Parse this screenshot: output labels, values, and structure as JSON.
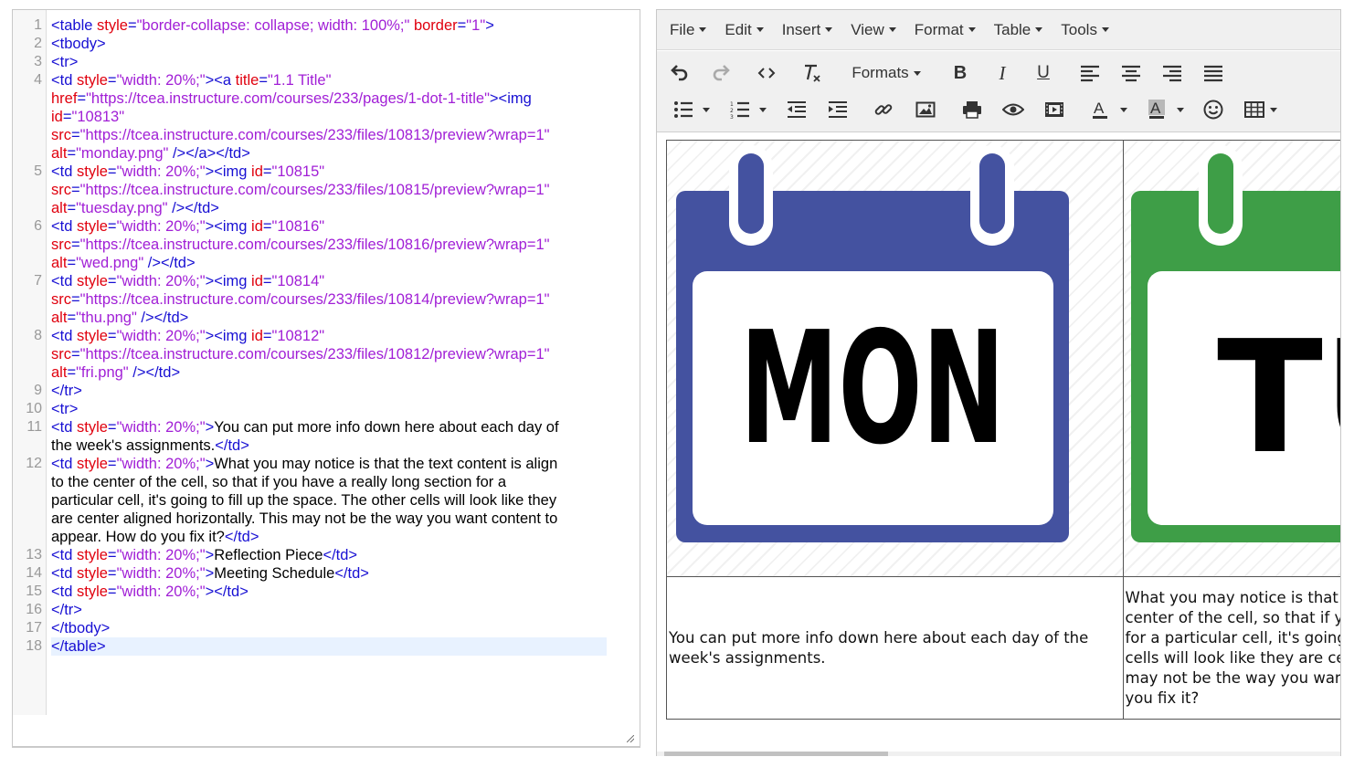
{
  "code_editor": {
    "lines": [
      {
        "n": "1",
        "parts": [
          [
            "t",
            "<table "
          ],
          [
            "a",
            "style"
          ],
          [
            "t",
            "="
          ],
          [
            "s",
            "\"border-collapse: collapse; width: 100%;\""
          ],
          [
            "a",
            " border"
          ],
          [
            "t",
            "="
          ],
          [
            "s",
            "\"1\""
          ],
          [
            "t",
            ">"
          ]
        ]
      },
      {
        "n": "2",
        "parts": [
          [
            "t",
            "<tbody>"
          ]
        ]
      },
      {
        "n": "3",
        "parts": [
          [
            "t",
            "<tr>"
          ]
        ]
      },
      {
        "n": "4",
        "parts": [
          [
            "t",
            "<td "
          ],
          [
            "a",
            "style"
          ],
          [
            "t",
            "="
          ],
          [
            "s",
            "\"width: 20%;\""
          ],
          [
            "t",
            "><a "
          ],
          [
            "a",
            "title"
          ],
          [
            "t",
            "="
          ],
          [
            "s",
            "\"1.1 Title\""
          ],
          [
            "a",
            "\nhref"
          ],
          [
            "t",
            "="
          ],
          [
            "s",
            "\"https://tcea.instructure.com/courses/233/pages/1-dot-1-title\""
          ],
          [
            "t",
            "><img\n"
          ],
          [
            "a",
            "id"
          ],
          [
            "t",
            "="
          ],
          [
            "s",
            "\"10813\"\n"
          ],
          [
            "a",
            "src"
          ],
          [
            "t",
            "="
          ],
          [
            "s",
            "\"https://tcea.instructure.com/courses/233/files/10813/preview?wrap=1\"\n"
          ],
          [
            "a",
            "alt"
          ],
          [
            "t",
            "="
          ],
          [
            "s",
            "\"monday.png\""
          ],
          [
            "t",
            " /></a></td>"
          ]
        ]
      },
      {
        "n": "5",
        "parts": [
          [
            "t",
            "<td "
          ],
          [
            "a",
            "style"
          ],
          [
            "t",
            "="
          ],
          [
            "s",
            "\"width: 20%;\""
          ],
          [
            "t",
            "><img "
          ],
          [
            "a",
            "id"
          ],
          [
            "t",
            "="
          ],
          [
            "s",
            "\"10815\"\n"
          ],
          [
            "a",
            "src"
          ],
          [
            "t",
            "="
          ],
          [
            "s",
            "\"https://tcea.instructure.com/courses/233/files/10815/preview?wrap=1\"\n"
          ],
          [
            "a",
            "alt"
          ],
          [
            "t",
            "="
          ],
          [
            "s",
            "\"tuesday.png\""
          ],
          [
            "t",
            " /></td>"
          ]
        ]
      },
      {
        "n": "6",
        "parts": [
          [
            "t",
            "<td "
          ],
          [
            "a",
            "style"
          ],
          [
            "t",
            "="
          ],
          [
            "s",
            "\"width: 20%;\""
          ],
          [
            "t",
            "><img "
          ],
          [
            "a",
            "id"
          ],
          [
            "t",
            "="
          ],
          [
            "s",
            "\"10816\"\n"
          ],
          [
            "a",
            "src"
          ],
          [
            "t",
            "="
          ],
          [
            "s",
            "\"https://tcea.instructure.com/courses/233/files/10816/preview?wrap=1\"\n"
          ],
          [
            "a",
            "alt"
          ],
          [
            "t",
            "="
          ],
          [
            "s",
            "\"wed.png\""
          ],
          [
            "t",
            " /></td>"
          ]
        ]
      },
      {
        "n": "7",
        "parts": [
          [
            "t",
            "<td "
          ],
          [
            "a",
            "style"
          ],
          [
            "t",
            "="
          ],
          [
            "s",
            "\"width: 20%;\""
          ],
          [
            "t",
            "><img "
          ],
          [
            "a",
            "id"
          ],
          [
            "t",
            "="
          ],
          [
            "s",
            "\"10814\"\n"
          ],
          [
            "a",
            "src"
          ],
          [
            "t",
            "="
          ],
          [
            "s",
            "\"https://tcea.instructure.com/courses/233/files/10814/preview?wrap=1\"\n"
          ],
          [
            "a",
            "alt"
          ],
          [
            "t",
            "="
          ],
          [
            "s",
            "\"thu.png\""
          ],
          [
            "t",
            " /></td>"
          ]
        ]
      },
      {
        "n": "8",
        "parts": [
          [
            "t",
            "<td "
          ],
          [
            "a",
            "style"
          ],
          [
            "t",
            "="
          ],
          [
            "s",
            "\"width: 20%;\""
          ],
          [
            "t",
            "><img "
          ],
          [
            "a",
            "id"
          ],
          [
            "t",
            "="
          ],
          [
            "s",
            "\"10812\"\n"
          ],
          [
            "a",
            "src"
          ],
          [
            "t",
            "="
          ],
          [
            "s",
            "\"https://tcea.instructure.com/courses/233/files/10812/preview?wrap=1\"\n"
          ],
          [
            "a",
            "alt"
          ],
          [
            "t",
            "="
          ],
          [
            "s",
            "\"fri.png\""
          ],
          [
            "t",
            " /></td>"
          ]
        ]
      },
      {
        "n": "9",
        "parts": [
          [
            "t",
            "</tr>"
          ]
        ]
      },
      {
        "n": "10",
        "parts": [
          [
            "t",
            "<tr>"
          ]
        ]
      },
      {
        "n": "11",
        "parts": [
          [
            "t",
            "<td "
          ],
          [
            "a",
            "style"
          ],
          [
            "t",
            "="
          ],
          [
            "s",
            "\"width: 20%;\""
          ],
          [
            "t",
            ">"
          ],
          [
            "x",
            "You can put more info down here about each day of\nthe week's assignments."
          ],
          [
            "t",
            "</td>"
          ]
        ]
      },
      {
        "n": "12",
        "parts": [
          [
            "t",
            "<td "
          ],
          [
            "a",
            "style"
          ],
          [
            "t",
            "="
          ],
          [
            "s",
            "\"width: 20%;\""
          ],
          [
            "t",
            ">"
          ],
          [
            "x",
            "What you may notice is that the text content is align\nto the center of the cell, so that if you have a really long section for a\nparticular cell, it's going to fill up the space. The other cells will look like they\nare center aligned horizontally. This may not be the way you want content to\nappear. How do you fix it?"
          ],
          [
            "t",
            "</td>"
          ]
        ]
      },
      {
        "n": "13",
        "parts": [
          [
            "t",
            "<td "
          ],
          [
            "a",
            "style"
          ],
          [
            "t",
            "="
          ],
          [
            "s",
            "\"width: 20%;\""
          ],
          [
            "t",
            ">"
          ],
          [
            "x",
            "Reflection Piece"
          ],
          [
            "t",
            "</td>"
          ]
        ]
      },
      {
        "n": "14",
        "parts": [
          [
            "t",
            "<td "
          ],
          [
            "a",
            "style"
          ],
          [
            "t",
            "="
          ],
          [
            "s",
            "\"width: 20%;\""
          ],
          [
            "t",
            ">"
          ],
          [
            "x",
            "Meeting Schedule"
          ],
          [
            "t",
            "</td>"
          ]
        ]
      },
      {
        "n": "15",
        "parts": [
          [
            "t",
            "<td "
          ],
          [
            "a",
            "style"
          ],
          [
            "t",
            "="
          ],
          [
            "s",
            "\"width: 20%;\""
          ],
          [
            "t",
            "></td>"
          ]
        ]
      },
      {
        "n": "16",
        "parts": [
          [
            "t",
            "</tr>"
          ]
        ]
      },
      {
        "n": "17",
        "parts": [
          [
            "t",
            "</tbody>"
          ]
        ]
      },
      {
        "n": "18",
        "parts": [
          [
            "t",
            "</table>"
          ]
        ],
        "active": true
      }
    ]
  },
  "menubar": {
    "items": [
      "File",
      "Edit",
      "Insert",
      "View",
      "Format",
      "Table",
      "Tools"
    ]
  },
  "toolbar": {
    "formats_label": "Formats",
    "bold_glyph": "B",
    "italic_glyph": "I",
    "underline_glyph": "U",
    "icons": [
      "undo-icon",
      "redo-icon",
      "source-code-icon",
      "clear-formatting-icon",
      "bold-icon",
      "italic-icon",
      "underline-icon",
      "align-left-icon",
      "align-center-icon",
      "align-right-icon",
      "justify-icon",
      "bullet-list-icon",
      "numbered-list-icon",
      "outdent-icon",
      "indent-icon",
      "link-icon",
      "image-icon",
      "print-icon",
      "preview-icon",
      "media-icon",
      "text-color-icon",
      "background-color-icon",
      "emoticons-icon",
      "table-icon"
    ]
  },
  "content": {
    "day1_text": "MON",
    "day2_text": "TU",
    "day1_color": "#4452a0",
    "day2_color": "#3e9e47",
    "cell1_text": "You can put more info down here about each day of the week's assignments.",
    "cell2_text": "What you may notice is that the text content is align to the center of the cell, so that if you have a really long section for a particular cell, it's going to fill up the space. The other cells will look like they are center aligned horizontally. This may not be the way you want content to appear. How do you fix it?"
  }
}
